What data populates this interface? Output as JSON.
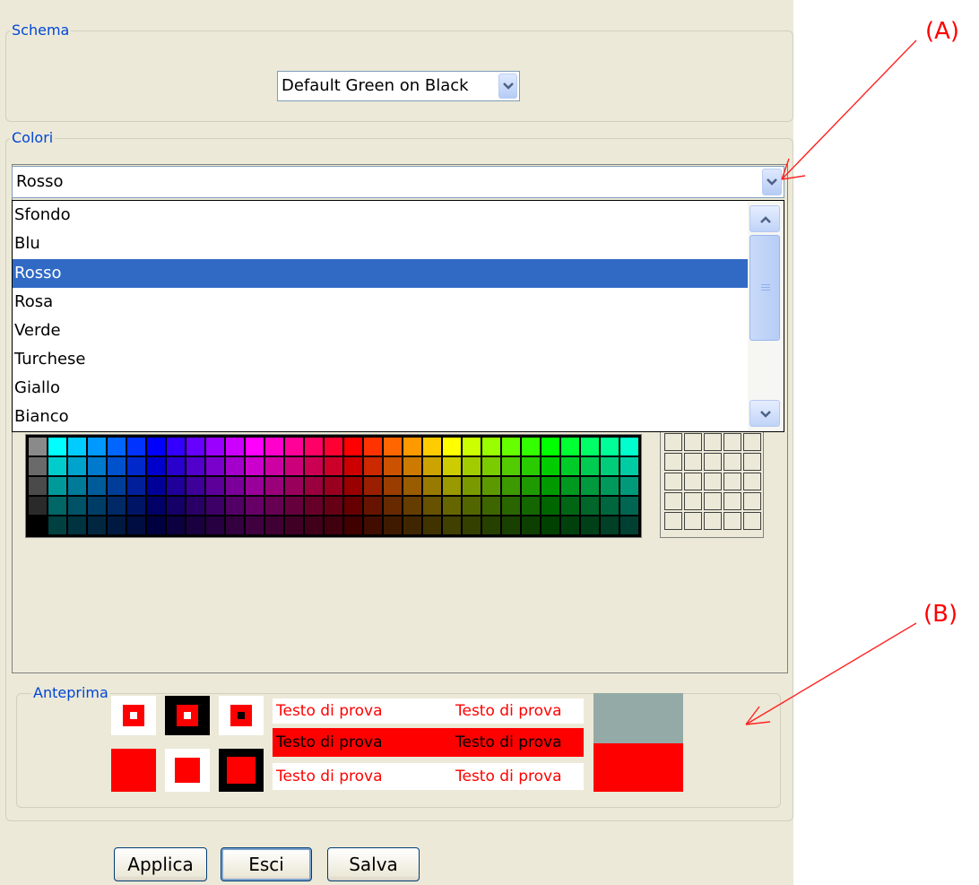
{
  "schema": {
    "legend": "Schema",
    "selected": "Default Green on Black"
  },
  "colori": {
    "legend": "Colori",
    "selected": "Rosso",
    "options": [
      "Sfondo",
      "Blu",
      "Rosso",
      "Rosa",
      "Verde",
      "Turchese",
      "Giallo",
      "Bianco"
    ],
    "highlighted_index": 2
  },
  "preview": {
    "legend": "Anteprima",
    "sample_text": "Testo di prova"
  },
  "buttons": {
    "apply": "Applica",
    "exit": "Esci",
    "save": "Salva"
  },
  "annotations": {
    "a": "(A)",
    "b": "(B)"
  },
  "colors": {
    "accent_red": "#ff0000",
    "selection_blue": "#316ac5",
    "legend_blue": "#0046d5",
    "preview_gray": "#94aaa6",
    "panel_bg": "#ece9d8"
  },
  "icons": [
    "chevron-down-icon",
    "chevron-up-icon",
    "scroll-thumb-grip-icon",
    "arrow-icon"
  ]
}
